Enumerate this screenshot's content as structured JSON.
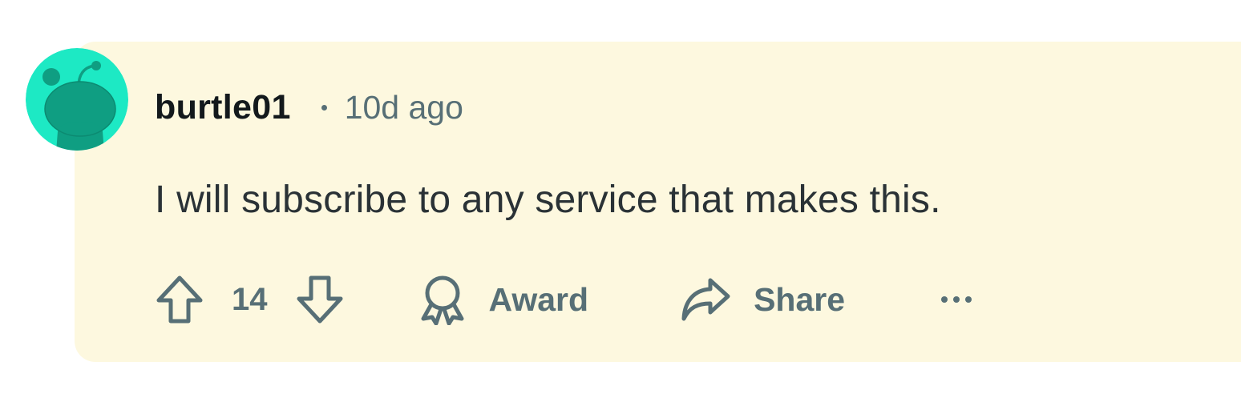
{
  "comment": {
    "author": "burtle01",
    "timestamp": "10d ago",
    "body": "I will subscribe to any service that makes this.",
    "score": "14"
  },
  "actions": {
    "award_label": "Award",
    "share_label": "Share"
  },
  "icons": {
    "avatar": "snoo-avatar-icon",
    "upvote": "upvote-arrow-icon",
    "downvote": "downvote-arrow-icon",
    "award": "award-ribbon-icon",
    "share": "share-arrow-icon",
    "more": "more-options-icon"
  },
  "colors": {
    "card_background": "#fdf8df",
    "avatar_background": "#1de9c4",
    "snoo_body": "#0f9e82",
    "text_primary": "#13191c",
    "text_secondary": "#576f76"
  }
}
